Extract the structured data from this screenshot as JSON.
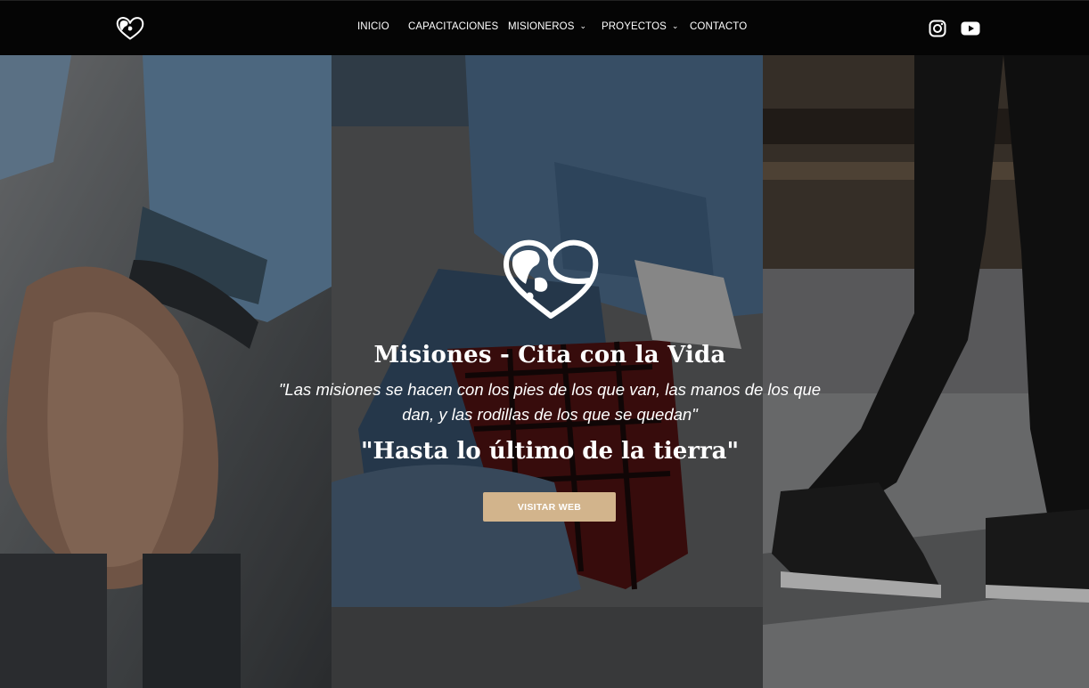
{
  "nav": {
    "logo_icon": "heart-globe-icon",
    "items": [
      {
        "label": "INICIO",
        "has_dropdown": false
      },
      {
        "label": "CAPACITACIONES",
        "has_dropdown": false
      },
      {
        "label": "MISIONEROS",
        "has_dropdown": true
      },
      {
        "label": "PROYECTOS",
        "has_dropdown": true
      },
      {
        "label": "CONTACTO",
        "has_dropdown": false
      }
    ],
    "dropdown_glyph": "⌄",
    "social": [
      {
        "name": "instagram-icon"
      },
      {
        "name": "youtube-icon"
      }
    ]
  },
  "hero": {
    "logo_icon": "heart-globe-icon",
    "title": "Misiones - Cita con la Vida",
    "quote": "\"Las misiones se hacen con los pies de los que van, las manos de los que dan, y las rodillas de los que se quedan\"",
    "subtitle": "\"Hasta lo último de la tierra\"",
    "cta_label": "VISITAR WEB"
  },
  "colors": {
    "nav_bg": "#050505",
    "cta_bg": "#d2b48c",
    "text": "#ffffff"
  }
}
